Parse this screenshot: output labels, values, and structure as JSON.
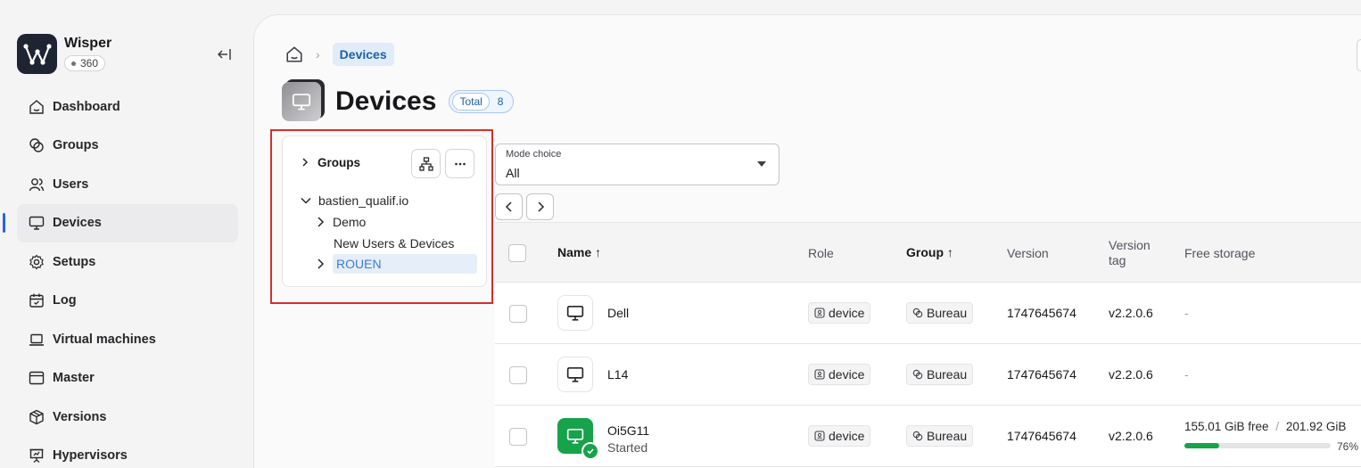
{
  "app": {
    "name": "Wisper",
    "badge": "360"
  },
  "sidebar": {
    "items": [
      {
        "label": "Dashboard",
        "icon": "home-icon"
      },
      {
        "label": "Groups",
        "icon": "groups-icon"
      },
      {
        "label": "Users",
        "icon": "users-icon"
      },
      {
        "label": "Devices",
        "icon": "monitor-icon",
        "active": true
      },
      {
        "label": "Setups",
        "icon": "gear-icon"
      },
      {
        "label": "Log",
        "icon": "calendar-icon"
      },
      {
        "label": "Virtual machines",
        "icon": "laptop-icon"
      },
      {
        "label": "Master",
        "icon": "window-icon"
      },
      {
        "label": "Versions",
        "icon": "package-icon"
      },
      {
        "label": "Hypervisors",
        "icon": "presentation-icon"
      }
    ]
  },
  "breadcrumb": {
    "current": "Devices"
  },
  "page": {
    "title": "Devices",
    "total_label": "Total",
    "total_count": "8"
  },
  "tree": {
    "header": "Groups",
    "root": "bastien_qualif.io",
    "children": [
      {
        "label": "Demo",
        "has_children": true
      },
      {
        "label": "New Users & Devices",
        "has_children": false
      },
      {
        "label": "ROUEN",
        "has_children": true,
        "selected": true
      }
    ]
  },
  "mode": {
    "label": "Mode choice",
    "value": "All"
  },
  "table": {
    "headers": {
      "name": "Name ↑",
      "role": "Role",
      "group": "Group ↑",
      "version": "Version",
      "version_tag_1": "Version",
      "version_tag_2": "tag",
      "free_storage": "Free storage"
    },
    "rows": [
      {
        "name": "Dell",
        "status": "",
        "role": "device",
        "group": "Bureau",
        "version": "1747645674",
        "tag": "v2.2.0.6",
        "storage": "-"
      },
      {
        "name": "L14",
        "status": "",
        "role": "device",
        "group": "Bureau",
        "version": "1747645674",
        "tag": "v2.2.0.6",
        "storage": "-"
      },
      {
        "name": "Oi5G11",
        "status": "Started",
        "role": "device",
        "group": "Bureau",
        "version": "1747645674",
        "tag": "v2.2.0.6",
        "storage_free": "155.01 GiB free",
        "storage_sep": "/",
        "storage_total": "201.92 GiB",
        "storage_pct": "76%",
        "storage_fraction": 0.24,
        "started": true
      }
    ]
  },
  "colors": {
    "accent": "#2563eb",
    "success": "#16a34a",
    "highlight": "#d32f2f"
  }
}
